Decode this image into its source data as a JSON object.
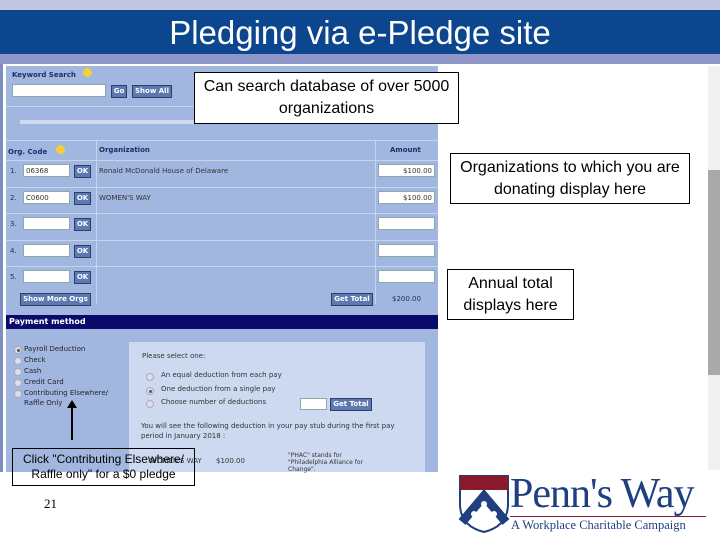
{
  "slide": {
    "title": "Pledging via e-Pledge site",
    "page_number": "21"
  },
  "search": {
    "label": "Keyword Search",
    "go": "Go",
    "show_all": "Show All",
    "value": ""
  },
  "table": {
    "headers": {
      "code": "Org. Code",
      "org": "Organization",
      "amount": "Amount"
    },
    "rows": [
      {
        "num": "1.",
        "code": "06368",
        "org": "Ronald McDonald House of Delaware",
        "amount": "$100.00"
      },
      {
        "num": "2.",
        "code": "C0600",
        "org": "WOMEN'S WAY",
        "amount": "$100.00"
      },
      {
        "num": "3.",
        "code": "",
        "org": "",
        "amount": ""
      },
      {
        "num": "4.",
        "code": "",
        "org": "",
        "amount": ""
      },
      {
        "num": "5.",
        "code": "",
        "org": "",
        "amount": ""
      }
    ],
    "ok": "OK",
    "show_more": "Show More Orgs",
    "get_total": "Get Total",
    "total": "$200.00"
  },
  "payment": {
    "title": "Payment method",
    "methods": [
      {
        "label": "Payroll Deduction",
        "selected": true
      },
      {
        "label": "Check",
        "selected": false
      },
      {
        "label": "Cash",
        "selected": false
      },
      {
        "label": "Credit Card",
        "selected": false
      },
      {
        "label": "Contributing Elsewhere/ Raffle Only",
        "selected": false
      }
    ],
    "select_prompt": "Please select one:",
    "options": [
      {
        "label": "An equal deduction from each pay",
        "selected": false
      },
      {
        "label": "One deduction from a single pay",
        "selected": true
      },
      {
        "label": "Choose number of deductions",
        "selected": false
      }
    ],
    "get_total": "Get Total",
    "info": "You will see the following deduction in your pay stub during the first pay period in January 2018 :",
    "deduction_org": "WOMEN'S WAY",
    "deduction_amount": "$100.00",
    "note": "\"PHAC\" stands for \"Philadelphia Alliance for Change\"."
  },
  "callouts": {
    "search": "Can search database of over 5000 organizations",
    "orgs": "Organizations to which you are donating display here",
    "total": "Annual total displays here",
    "raffle": "Click \"Contributing Elsewhere/ Raffle only\" for a $0 pledge"
  },
  "logo": {
    "name": "Penn's Way",
    "tagline": "A Workplace Charitable Campaign"
  },
  "colors": {
    "title_bar": "#0b468e",
    "form_bg": "#a2b7df",
    "payment_bar": "#0a0a6a",
    "logo_blue": "#1f3f7f",
    "logo_red": "#8b1a2e"
  }
}
